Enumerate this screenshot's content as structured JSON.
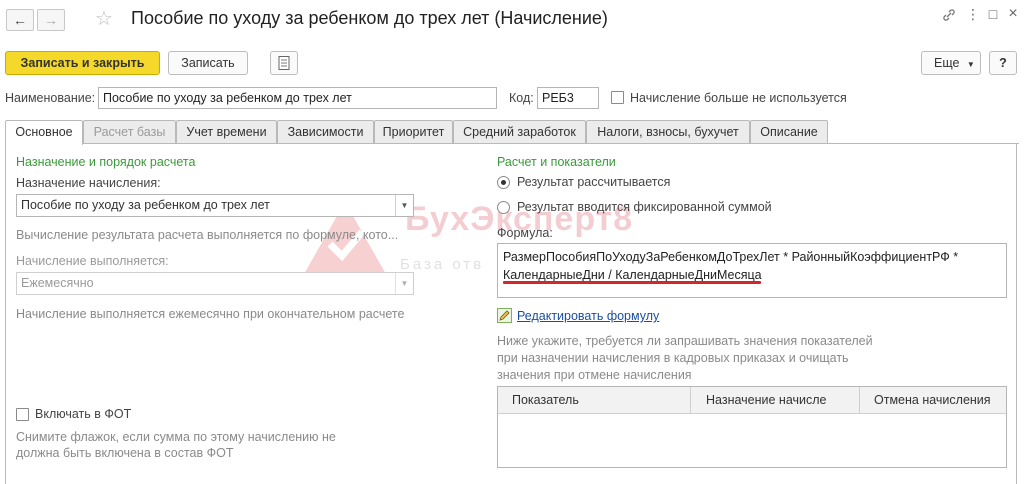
{
  "window": {
    "title": "Пособие по уходу за ребенком до трех лет (Начисление)",
    "back_icon": "arrow-left-icon",
    "forward_icon": "arrow-right-icon",
    "favorite_icon": "star-icon"
  },
  "toolbar": {
    "save_close_label": "Записать и закрыть",
    "save_label": "Записать",
    "more_label": "Еще",
    "help_label": "?"
  },
  "header": {
    "name_label": "Наименование:",
    "name_value": "Пособие по уходу за ребенком до трех лет",
    "code_label": "Код:",
    "code_value": "РЕБ3",
    "not_used_label": "Начисление больше не используется",
    "not_used_checked": false
  },
  "tabs": [
    {
      "label": "Основное",
      "active": true
    },
    {
      "label": "Расчет базы",
      "disabled": true
    },
    {
      "label": "Учет времени"
    },
    {
      "label": "Зависимости"
    },
    {
      "label": "Приоритет"
    },
    {
      "label": "Средний заработок"
    },
    {
      "label": "Налоги, взносы, бухучет"
    },
    {
      "label": "Описание"
    }
  ],
  "left": {
    "section_title": "Назначение и порядок расчета",
    "purpose_label": "Назначение начисления:",
    "purpose_value": "Пособие по уходу за ребенком до трех лет",
    "calc_hint": "Вычисление результата расчета выполняется по формуле, кото...",
    "frequency_label": "Начисление выполняется:",
    "frequency_value": "Ежемесячно",
    "frequency_hint": "Начисление выполняется ежемесячно при окончательном расчете",
    "fot_label": "Включать в ФОТ",
    "fot_checked": false,
    "fot_hint_line1": "Снимите флажок, если сумма по этому начислению не",
    "fot_hint_line2": "должна быть включена в состав ФОТ"
  },
  "right": {
    "section_title": "Расчет и показатели",
    "radio_calculated": "Результат рассчитывается",
    "radio_fixed": "Результат вводится фиксированной суммой",
    "formula_label": "Формула:",
    "formula_line1": "РазмерПособияПоУходуЗаРебенкомДоТрехЛет * РайонныйКоэффициентРФ *",
    "formula_line2": "КалендарныеДни / КалендарныеДниМесяца",
    "edit_formula_label": "Редактировать формулу",
    "indicators_hint_line1": "Ниже укажите, требуется ли запрашивать значения показателей",
    "indicators_hint_line2": "при назначении начисления в кадровых приказах и очищать",
    "indicators_hint_line3": "значения при отмене начисления",
    "grid_columns": [
      "Показатель",
      "Назначение начисле",
      "Отмена начисления"
    ]
  },
  "watermark": {
    "text": "БухЭксперт8",
    "subtext": "База отв"
  },
  "colors": {
    "primary_button": "#f5d92a",
    "section_title": "#3a9a3a",
    "link": "#1a4e9c",
    "underline_highlight": "#d7262b"
  }
}
